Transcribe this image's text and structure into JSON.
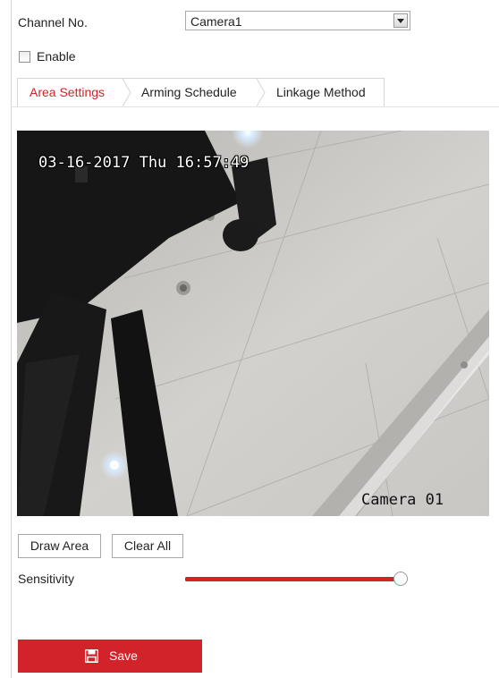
{
  "channel": {
    "label": "Channel No.",
    "value": "Camera1"
  },
  "enable": {
    "label": "Enable",
    "checked": false
  },
  "tabs": [
    {
      "label": "Area Settings",
      "active": true
    },
    {
      "label": "Arming Schedule",
      "active": false
    },
    {
      "label": "Linkage Method",
      "active": false
    }
  ],
  "video": {
    "timestamp": "03-16-2017 Thu 16:57:49",
    "camera_name": "Camera 01"
  },
  "actions": {
    "draw_area": "Draw Area",
    "clear_all": "Clear All"
  },
  "sensitivity": {
    "label": "Sensitivity",
    "value_fraction": 1.0
  },
  "save": {
    "label": "Save",
    "icon": "floppy-disk-icon"
  },
  "colors": {
    "accent": "#d2232a",
    "tab_border": "#d6d6d6"
  }
}
